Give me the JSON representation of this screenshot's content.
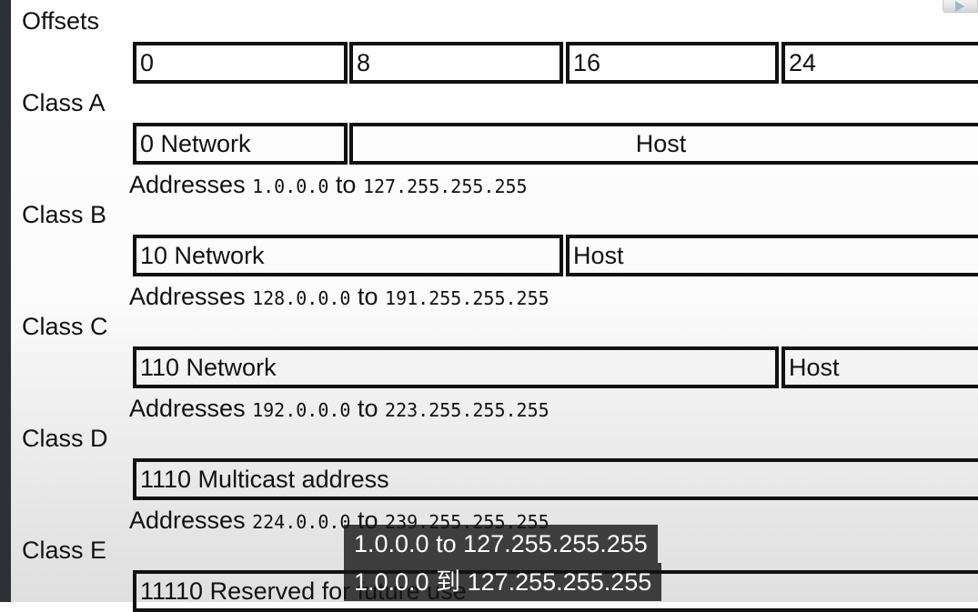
{
  "labels": {
    "offsets": "Offsets",
    "class_a": "Class A",
    "class_b": "Class B",
    "class_c": "Class C",
    "class_d": "Class D",
    "class_e": "Class E"
  },
  "offsets": [
    "0",
    "8",
    "16",
    "24"
  ],
  "class_a": {
    "network": "0  Network",
    "host": "Host",
    "addr_word": "Addresses",
    "from": "1.0.0.0",
    "to_word": "to",
    "to": "127.255.255.255"
  },
  "class_b": {
    "network": "10  Network",
    "host": "Host",
    "addr_word": "Addresses",
    "from": "128.0.0.0",
    "to_word": "to",
    "to": "191.255.255.255"
  },
  "class_c": {
    "network": "110  Network",
    "host": "Host",
    "addr_word": "Addresses",
    "from": "192.0.0.0",
    "to_word": "to",
    "to": "223.255.255.255"
  },
  "class_d": {
    "field": "1110  Multicast address",
    "addr_word": "Addresses",
    "from": "224.0.0.0",
    "to_word": "to",
    "to": "239.255.255.255"
  },
  "class_e": {
    "field": "11110  Reserved for future use"
  },
  "subtitles": [
    "1.0.0.0 to 127.255.255.255",
    "1.0.0.0 到 127.255.255.255"
  ],
  "icons": {
    "top_right": "play-icon"
  }
}
